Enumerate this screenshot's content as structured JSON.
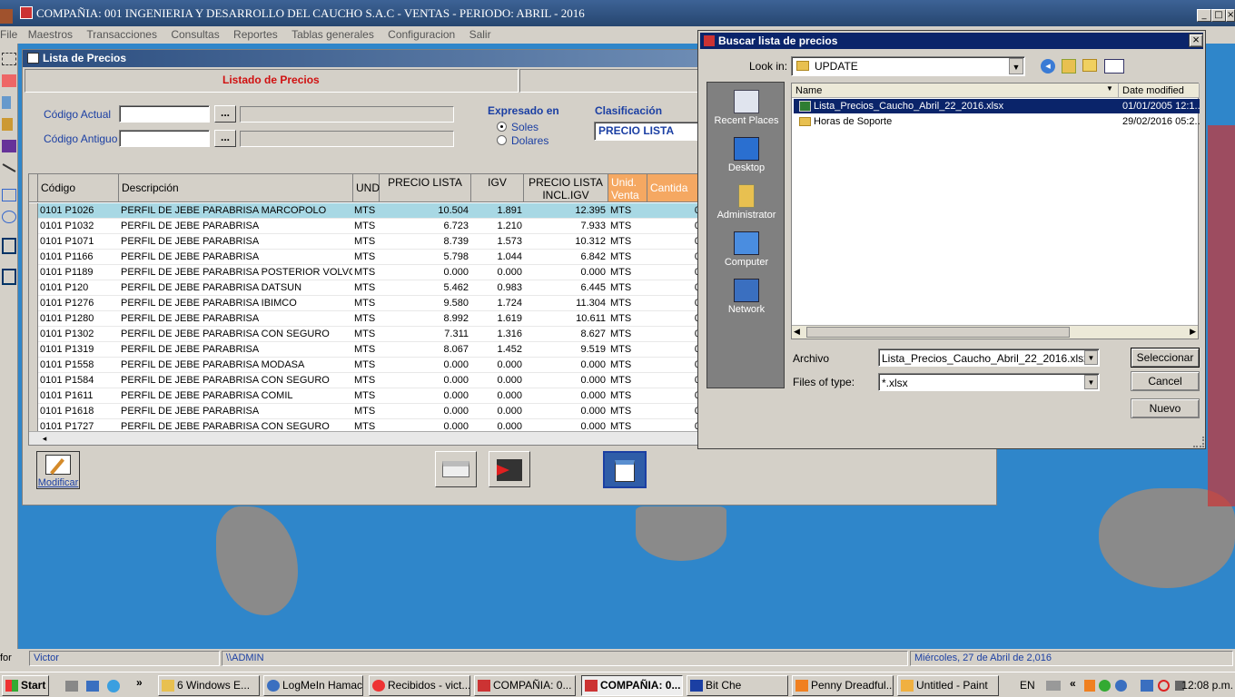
{
  "window": {
    "title": "COMPAÑIA: 001 INGENIERIA Y DESARROLLO DEL CAUCHO S.A.C  -  VENTAS  -   PERIODO: ABRIL - 2016",
    "min": "_",
    "max": "□",
    "close": "×"
  },
  "menu": [
    "File",
    "Maestros",
    "Transacciones",
    "Consultas",
    "Reportes",
    "Tablas generales",
    "Configuracion",
    "Salir"
  ],
  "lista": {
    "title": "Lista de Precios",
    "listado_label": "Listado de Precios",
    "codigo_actual_label": "Código Actual",
    "codigo_antiguo_label": "Código Antiguo",
    "codigo_actual_value": "",
    "codigo_antiguo_value": "",
    "dots": "...",
    "expresado_label": "Expresado en",
    "soles_label": "Soles",
    "dolares_label": "Dolares",
    "clasificacion_label": "Clasificación",
    "clasificacion_value": "PRECIO LISTA",
    "modificar_label": "Modificar",
    "columns": [
      "Código",
      "Descripción",
      "UND",
      "PRECIO LISTA",
      "IGV",
      "PRECIO LISTA\nINCL.IGV",
      "Unid.\nVenta",
      "Cantida"
    ],
    "rows": [
      [
        "0101  P1026",
        "PERFIL DE JEBE PARABRISA MARCOPOLO",
        "MTS",
        "10.504",
        "1.891",
        "12.395",
        "MTS",
        "0"
      ],
      [
        "0101  P1032",
        "PERFIL DE JEBE PARABRISA",
        "MTS",
        "6.723",
        "1.210",
        "7.933",
        "MTS",
        "0"
      ],
      [
        "0101  P1071",
        "PERFIL DE JEBE PARABRISA",
        "MTS",
        "8.739",
        "1.573",
        "10.312",
        "MTS",
        "0"
      ],
      [
        "0101  P1166",
        "PERFIL DE JEBE PARABRISA",
        "MTS",
        "5.798",
        "1.044",
        "6.842",
        "MTS",
        "0"
      ],
      [
        "0101  P1189",
        "PERFIL DE JEBE PARABRISA POSTERIOR VOLVO",
        "MTS",
        "0.000",
        "0.000",
        "0.000",
        "MTS",
        "0"
      ],
      [
        "0101  P120",
        "PERFIL DE JEBE PARABRISA DATSUN",
        "MTS",
        "5.462",
        "0.983",
        "6.445",
        "MTS",
        "0"
      ],
      [
        "0101  P1276",
        "PERFIL DE JEBE PARABRISA IBIMCO",
        "MTS",
        "9.580",
        "1.724",
        "11.304",
        "MTS",
        "0"
      ],
      [
        "0101  P1280",
        "PERFIL DE JEBE PARABRISA",
        "MTS",
        "8.992",
        "1.619",
        "10.611",
        "MTS",
        "0"
      ],
      [
        "0101  P1302",
        "PERFIL DE JEBE PARABRISA CON SEGURO",
        "MTS",
        "7.311",
        "1.316",
        "8.627",
        "MTS",
        "0"
      ],
      [
        "0101  P1319",
        "PERFIL DE JEBE PARABRISA",
        "MTS",
        "8.067",
        "1.452",
        "9.519",
        "MTS",
        "0"
      ],
      [
        "0101  P1558",
        "PERFIL DE JEBE PARABRISA MODASA",
        "MTS",
        "0.000",
        "0.000",
        "0.000",
        "MTS",
        "0"
      ],
      [
        "0101  P1584",
        "PERFIL DE JEBE PARABRISA CON SEGURO",
        "MTS",
        "0.000",
        "0.000",
        "0.000",
        "MTS",
        "0"
      ],
      [
        "0101  P1611",
        "PERFIL DE JEBE PARABRISA COMIL",
        "MTS",
        "0.000",
        "0.000",
        "0.000",
        "MTS",
        "0"
      ],
      [
        "0101  P1618",
        "PERFIL DE JEBE PARABRISA",
        "MTS",
        "0.000",
        "0.000",
        "0.000",
        "MTS",
        "0"
      ],
      [
        "0101  P1727",
        "PERFIL DE JEBE PARABRISA CON SEGURO",
        "MTS",
        "0.000",
        "0.000",
        "0.000",
        "MTS",
        "0"
      ]
    ]
  },
  "dialog": {
    "title": "Buscar lista de precios",
    "close": "×",
    "look_in_label": "Look in:",
    "look_in_value": "UPDATE",
    "places": [
      "Recent Places",
      "Desktop",
      "Administrator",
      "Computer",
      "Network"
    ],
    "col_name": "Name",
    "col_date": "Date modified",
    "files": [
      {
        "name": "Lista_Precios_Caucho_Abril_22_2016.xlsx",
        "date": "01/01/2005 12:1..."
      },
      {
        "name": "Horas de Soporte",
        "date": "29/02/2016 05:2..."
      }
    ],
    "archivo_label": "Archivo",
    "archivo_value": "Lista_Precios_Caucho_Abril_22_2016.xlsx",
    "filetype_label": "Files of type:",
    "filetype_value": "*.xlsx",
    "btn_select": "Seleccionar",
    "btn_cancel": "Cancel",
    "btn_new": "Nuevo"
  },
  "status": {
    "user": "Victor",
    "path": "\\\\ADMIN",
    "date": "Miércoles, 27 de Abril de 2,016",
    "left": "for"
  },
  "taskbar": {
    "start": "Start",
    "tasks": [
      "6 Windows E...",
      "LogMeIn Hamachi",
      "Recibidos - vict...",
      "COMPAÑIA: 0...",
      "COMPAÑIA: 0...",
      "Bit Che",
      "Penny Dreadful...",
      "Untitled - Paint"
    ],
    "lang": "EN",
    "time": "12:08 p.m."
  }
}
